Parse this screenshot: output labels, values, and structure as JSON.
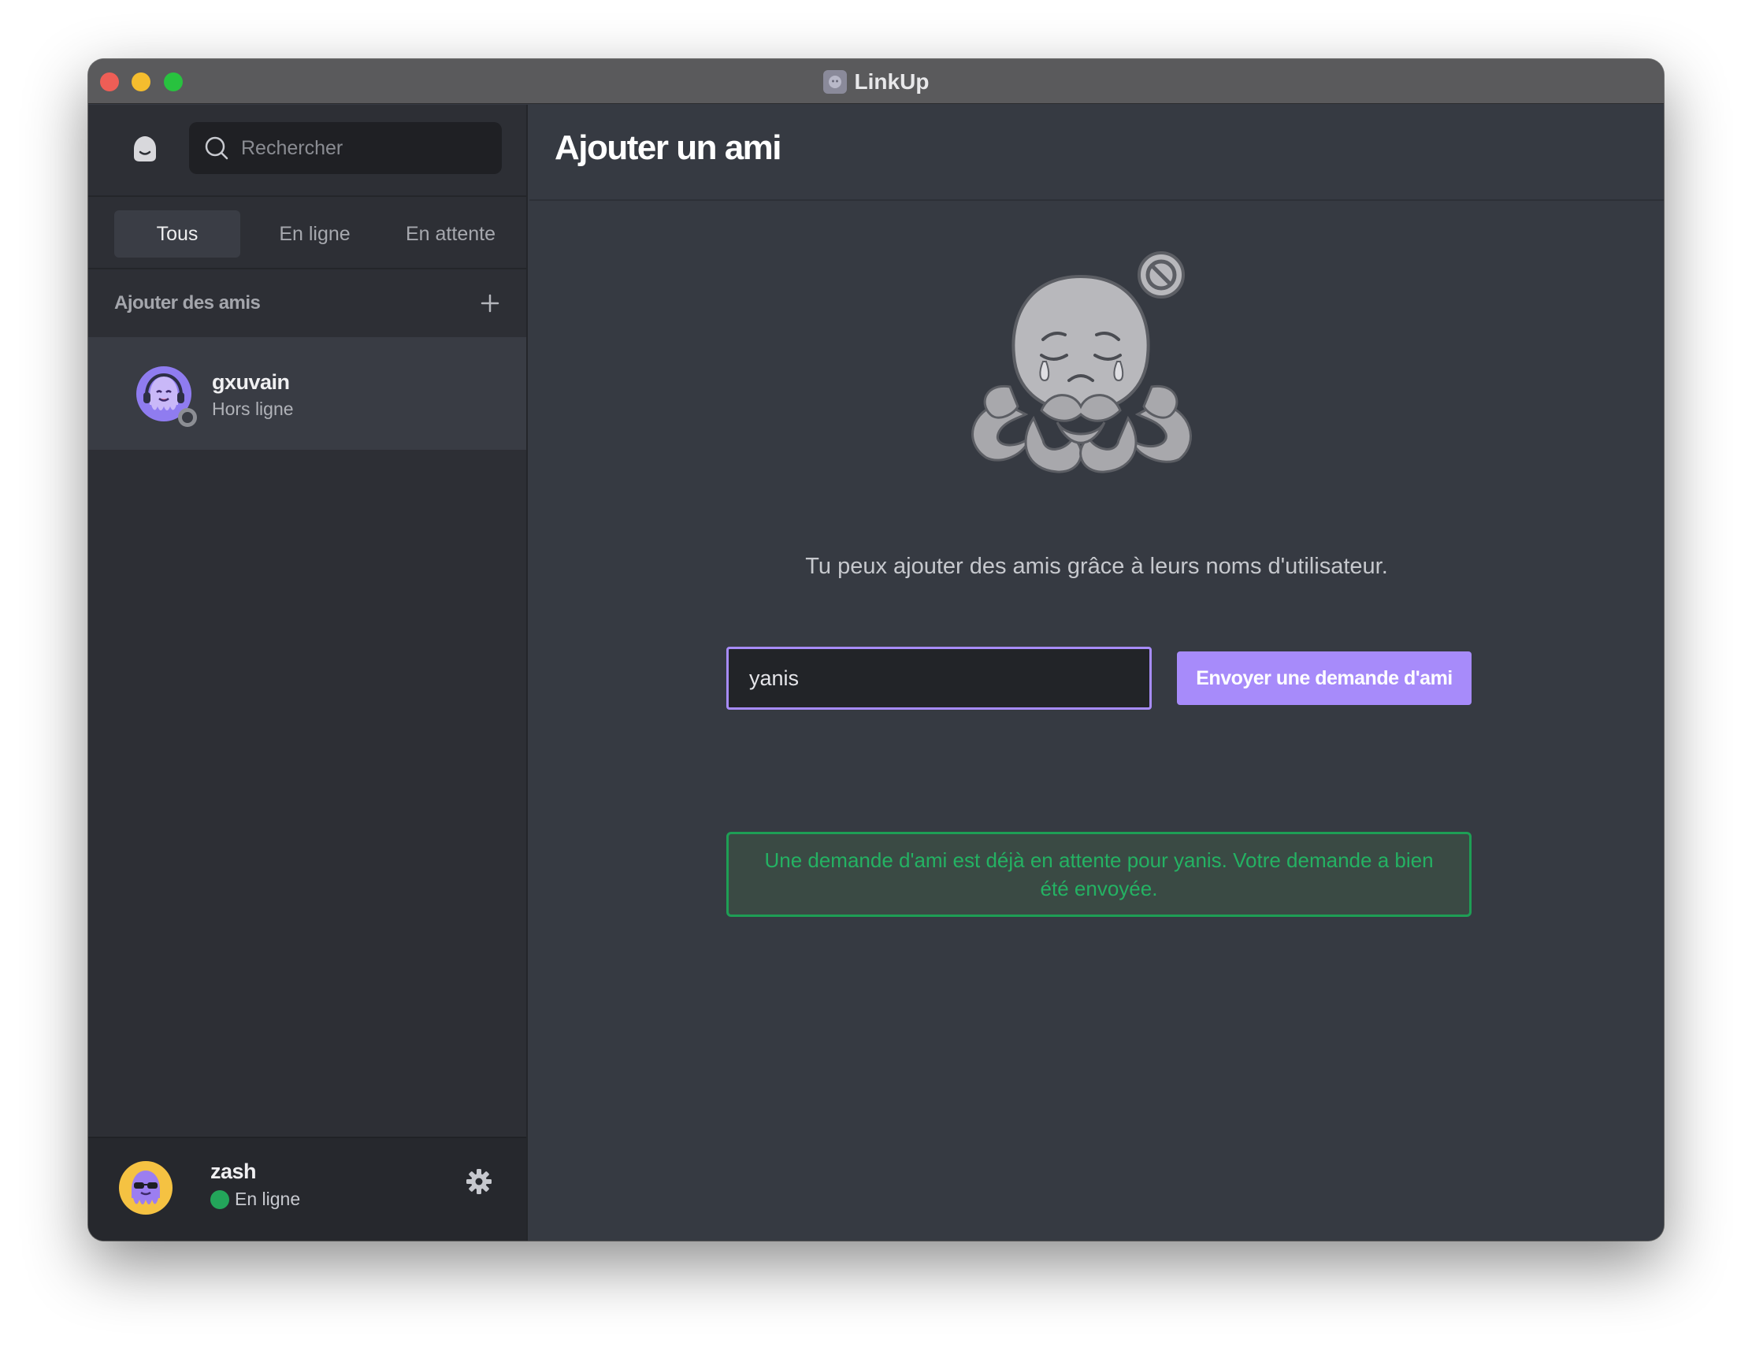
{
  "window": {
    "title": "LinkUp"
  },
  "sidebar": {
    "search": {
      "placeholder": "Rechercher",
      "value": ""
    },
    "tabs": [
      {
        "label": "Tous",
        "active": true
      },
      {
        "label": "En ligne",
        "active": false
      },
      {
        "label": "En attente",
        "active": false
      }
    ],
    "section": {
      "label": "Ajouter des amis"
    },
    "friends": [
      {
        "name": "gxuvain",
        "status": "Hors ligne"
      }
    ],
    "current_user": {
      "name": "zash",
      "status": "En ligne"
    }
  },
  "main": {
    "title": "Ajouter un ami",
    "hint": "Tu peux ajouter des amis grâce à leurs noms d'utilisateur.",
    "input_value": "yanis",
    "send_label": "Envoyer une demande d'ami",
    "alert": "Une demande d'ami est déjà en attente pour yanis. Votre demande a bien été envoyée."
  },
  "colors": {
    "accent": "#a78bfa",
    "success": "#24b263",
    "online": "#23a55a",
    "offline": "#8c8e94",
    "sidebar_bg": "#2d2f35",
    "main_bg": "#363a42"
  },
  "icons": [
    "home-icon",
    "search-icon",
    "plus-icon",
    "gear-icon",
    "app-icon",
    "sad-octopus-illustration",
    "blocked-icon"
  ]
}
